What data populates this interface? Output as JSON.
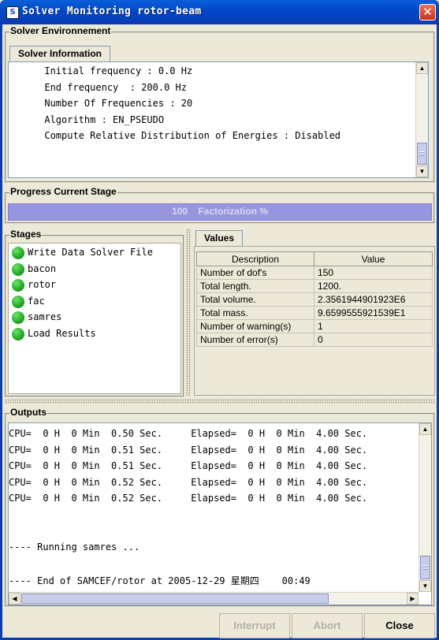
{
  "window": {
    "title": "Solver Monitoring rotor-beam",
    "icon_name": "solver-app-icon",
    "close_symbol": "✕"
  },
  "solver_environment": {
    "title": "Solver Environnement",
    "tab_label": "Solver Information",
    "lines": [
      "      Initial frequency : 0.0 Hz",
      "      End frequency  : 200.0 Hz",
      "      Number Of Frequencies : 20",
      "      Algorithm : EN_PSEUDO",
      "      Compute Relative Distribution of Energies : Disabled"
    ]
  },
  "progress": {
    "title": "Progress Current Stage",
    "value_text": "100",
    "label": "Factorization %",
    "fraction": 1.0
  },
  "stages": {
    "title": "Stages",
    "items": [
      {
        "label": "Write Data Solver File",
        "status": "done"
      },
      {
        "label": "bacon",
        "status": "done"
      },
      {
        "label": "rotor",
        "status": "done"
      },
      {
        "label": "fac",
        "status": "done"
      },
      {
        "label": "samres",
        "status": "done"
      },
      {
        "label": "Load Results",
        "status": "done"
      }
    ],
    "status_color": "#22a822"
  },
  "values": {
    "tab_label": "Values",
    "headers": [
      "Description",
      "Value"
    ],
    "rows": [
      [
        "Number of dof's",
        "150"
      ],
      [
        "Total length.",
        "1200."
      ],
      [
        "Total volume.",
        "2.3561944901923E6"
      ],
      [
        "Total mass.",
        "9.6599555921539E1"
      ],
      [
        "Number of warning(s)",
        "1"
      ],
      [
        "Number of error(s)",
        "0"
      ]
    ]
  },
  "outputs": {
    "title": "Outputs",
    "lines": [
      "CPU=  0 H  0 Min  0.50 Sec.     Elapsed=  0 H  0 Min  4.00 Sec.",
      "CPU=  0 H  0 Min  0.51 Sec.     Elapsed=  0 H  0 Min  4.00 Sec.",
      "CPU=  0 H  0 Min  0.51 Sec.     Elapsed=  0 H  0 Min  4.00 Sec.",
      "CPU=  0 H  0 Min  0.52 Sec.     Elapsed=  0 H  0 Min  4.00 Sec.",
      "CPU=  0 H  0 Min  0.52 Sec.     Elapsed=  0 H  0 Min  4.00 Sec.",
      "",
      "",
      "---- Running samres ...",
      "",
      "---- End of SAMCEF/rotor at 2005-12-29 星期四    00:49"
    ]
  },
  "buttons": {
    "interrupt": "Interrupt",
    "abort": "Abort",
    "close": "Close"
  },
  "colors": {
    "titlebar": "#0047c8",
    "progress": "#9c9be5",
    "stage_ok": "#22a822"
  }
}
